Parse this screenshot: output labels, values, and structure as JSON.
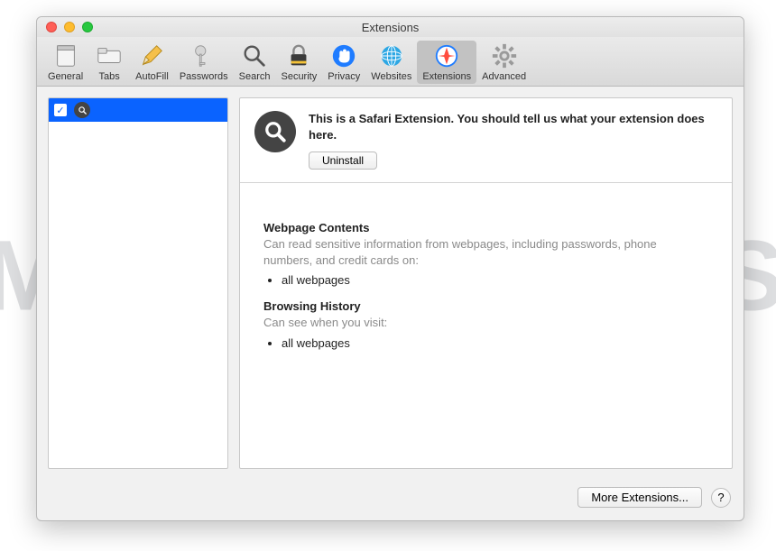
{
  "window": {
    "title": "Extensions"
  },
  "toolbar": {
    "items": [
      {
        "label": "General"
      },
      {
        "label": "Tabs"
      },
      {
        "label": "AutoFill"
      },
      {
        "label": "Passwords"
      },
      {
        "label": "Search"
      },
      {
        "label": "Security"
      },
      {
        "label": "Privacy"
      },
      {
        "label": "Websites"
      },
      {
        "label": "Extensions"
      },
      {
        "label": "Advanced"
      }
    ]
  },
  "sidebar": {
    "items": [
      {
        "checked": true,
        "name": ""
      }
    ]
  },
  "detail": {
    "description": "This is a Safari Extension. You should tell us what your extension does here.",
    "uninstall_label": "Uninstall",
    "permissions": [
      {
        "title": "Webpage Contents",
        "subtitle": "Can read sensitive information from webpages, including passwords, phone numbers, and credit cards on:",
        "items": [
          "all webpages"
        ]
      },
      {
        "title": "Browsing History",
        "subtitle": "Can see when you visit:",
        "items": [
          "all webpages"
        ]
      }
    ]
  },
  "footer": {
    "more_label": "More Extensions...",
    "help_label": "?"
  },
  "watermark": "MALWARETIPS"
}
